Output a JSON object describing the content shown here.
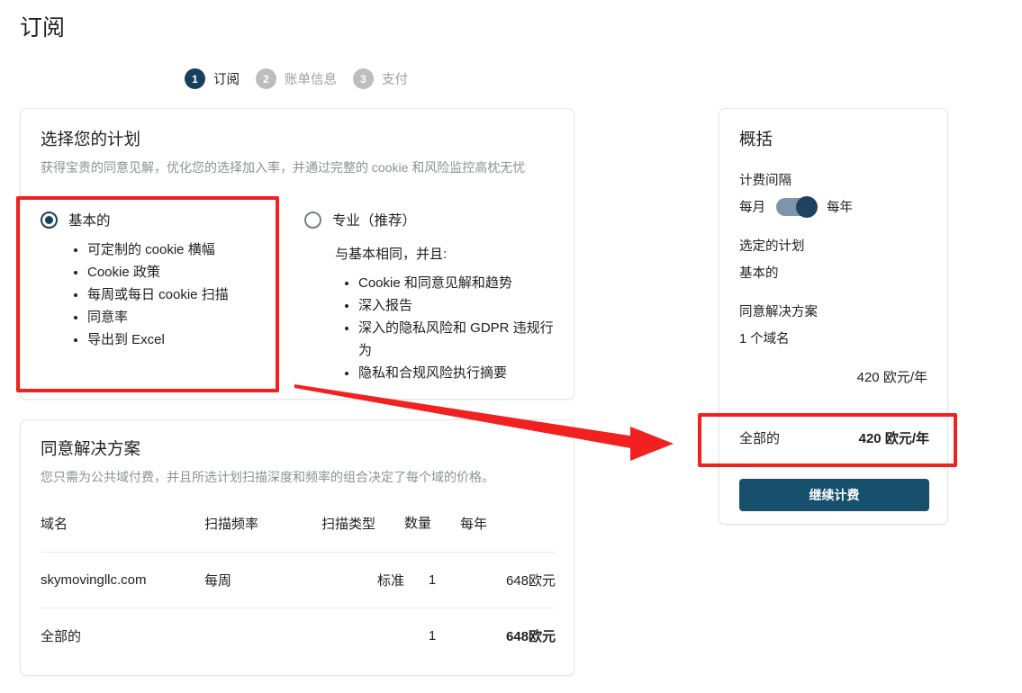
{
  "page": {
    "title": "订阅"
  },
  "stepper": {
    "steps": [
      {
        "num": "1",
        "label": "订阅",
        "state": "active"
      },
      {
        "num": "2",
        "label": "账单信息",
        "state": "inactive"
      },
      {
        "num": "3",
        "label": "支付",
        "state": "inactive"
      }
    ]
  },
  "plan_card": {
    "title": "选择您的计划",
    "subtitle": "获得宝贵的同意见解，优化您的选择加入率，并通过完整的 cookie 和风险监控高枕无忧",
    "basic": {
      "name": "基本的",
      "selected": true,
      "features": [
        "可定制的 cookie 横幅",
        "Cookie 政策",
        "每周或每日 cookie 扫描",
        "同意率",
        "导出到 Excel"
      ]
    },
    "professional": {
      "name": "专业（推荐）",
      "selected": false,
      "note": "与基本相同，并且:",
      "features": [
        "Cookie 和同意见解和趋势",
        "深入报告",
        "深入的隐私风险和 GDPR 违规行为",
        "隐私和合规风险执行摘要"
      ]
    }
  },
  "domains_card": {
    "title": "同意解决方案",
    "subtitle": "您只需为公共域付费，并且所选计划扫描深度和频率的组合决定了每个域的价格。",
    "columns": {
      "domain": "域名",
      "frequency": "扫描频率",
      "type": "扫描类型",
      "quantity_line1": "数",
      "quantity_line2": "量",
      "yearly": "每年"
    },
    "rows": [
      {
        "domain": "skymovingllc.com",
        "frequency": "每周",
        "type": "标准",
        "quantity": "1",
        "yearly": "648欧元"
      }
    ],
    "total": {
      "label": "全部的",
      "frequency": "",
      "type": "",
      "quantity": "1",
      "yearly": "648欧元"
    }
  },
  "summary_card": {
    "title": "概括",
    "billing_interval_label": "计费间隔",
    "interval_monthly": "每月",
    "interval_yearly": "每年",
    "interval_selected": "每年",
    "selected_plan_label": "选定的计划",
    "selected_plan_value": "基本的",
    "solution_label": "同意解决方案",
    "solution_value": "1 个域名",
    "solution_price": "420 欧元/年",
    "total_label": "全部的",
    "total_value": "420 欧元/年",
    "cta_label": "继续计费"
  },
  "annotations": {
    "highlight_color": "#f32020",
    "boxes": [
      {
        "name": "basic-plan-highlight"
      },
      {
        "name": "summary-total-highlight"
      }
    ],
    "arrow": {
      "name": "annotation-arrow",
      "from": "basic-plan-highlight",
      "to": "summary-total-highlight"
    }
  },
  "colors": {
    "accent_dark": "#17405c",
    "cta": "#17506d",
    "toggle_track": "#7d95ab",
    "toggle_knob": "#1e4260",
    "muted_text": "#8d9196"
  }
}
